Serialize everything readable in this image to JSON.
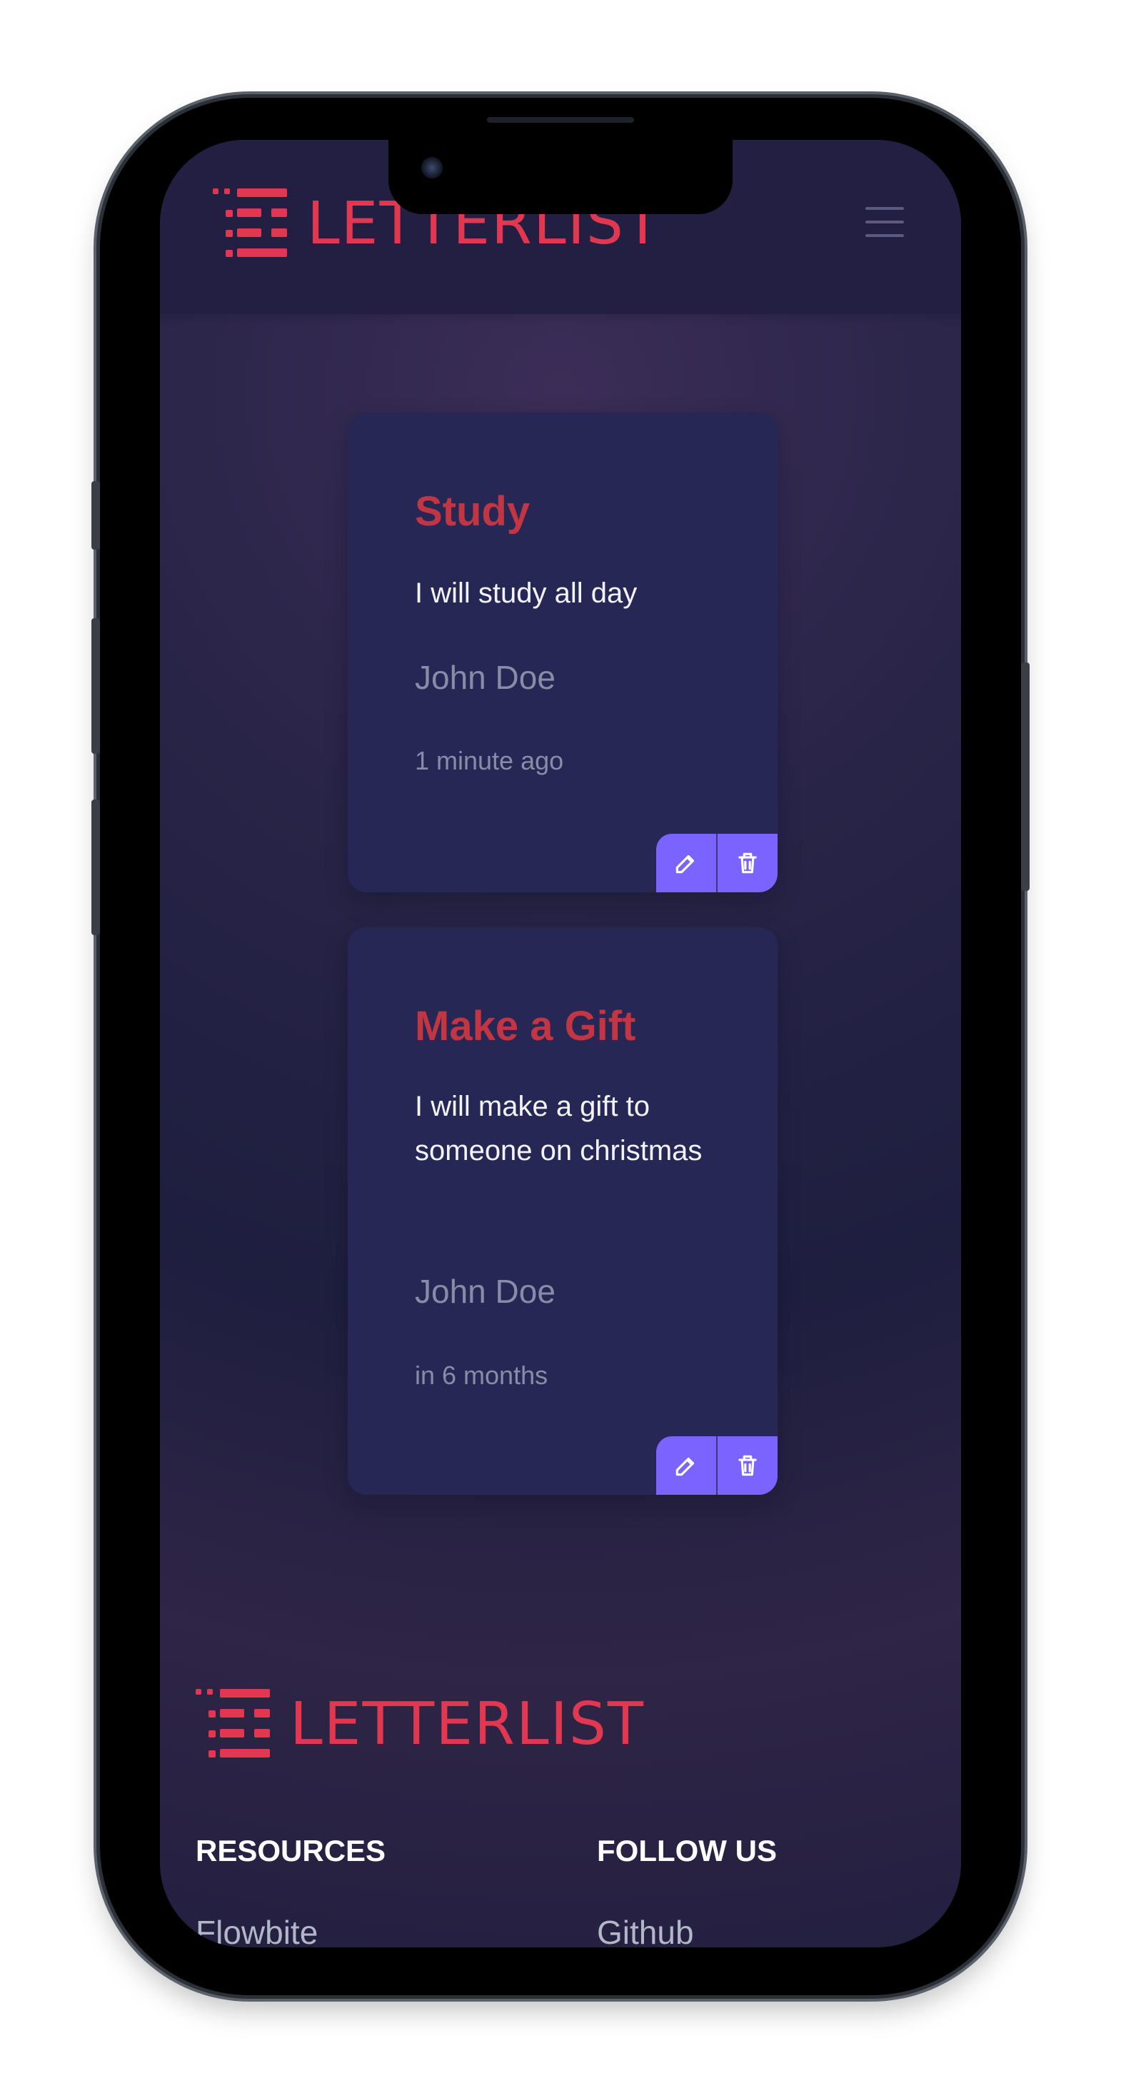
{
  "brand": {
    "name": "LETTERLIST",
    "accent_color": "#e23750"
  },
  "navigation": {
    "menu_icon": "hamburger-menu-icon"
  },
  "letters": [
    {
      "title": "Study",
      "body": "I will study all day",
      "author": "John Doe",
      "time": "1 minute ago",
      "edit_icon": "edit-icon",
      "delete_icon": "trash-icon"
    },
    {
      "title": "Make a Gift",
      "body": "I will make a gift to someone on christmas",
      "author": "John Doe",
      "time": "in 6 months",
      "edit_icon": "edit-icon",
      "delete_icon": "trash-icon"
    }
  ],
  "footer": {
    "brand_name": "LETTERLIST",
    "columns": [
      {
        "heading": "RESOURCES",
        "links": [
          "Flowbite"
        ]
      },
      {
        "heading": "FOLLOW US",
        "links": [
          "Github"
        ]
      }
    ]
  },
  "colors": {
    "background_top": "#3b2d57",
    "background_main": "#1e1e3f",
    "card": "#262754",
    "title": "#c23643",
    "action": "#7b63ff",
    "muted_text": "#8a8ca7"
  }
}
